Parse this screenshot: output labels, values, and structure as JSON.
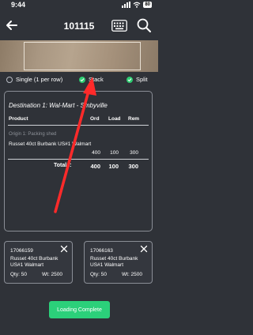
{
  "status_bar": {
    "time": "9:44",
    "battery": "80"
  },
  "header": {
    "title": "101115"
  },
  "modes": [
    {
      "label": "Single (1 per row)",
      "checked": false
    },
    {
      "label": "Stack",
      "checked": true
    },
    {
      "label": "Split",
      "checked": true
    }
  ],
  "order": {
    "destination": "Destination 1: Wal-Mart - Smbyville",
    "columns": [
      "Product",
      "Ord",
      "Load",
      "Rem"
    ],
    "origin": "Origin 1: Packing shed",
    "product": "Russet 40ct Burbank US#1 Walmart",
    "row": {
      "ord": "400",
      "load": "100",
      "rem": "300"
    },
    "totals_label": "Totals:",
    "totals": {
      "ord": "400",
      "load": "100",
      "rem": "300"
    }
  },
  "pallets": [
    {
      "id": "17066159",
      "product": "Russet 40ct Burbank US#1 Walmart",
      "qty": "Qty: 50",
      "wt": "Wt: 2500"
    },
    {
      "id": "17066163",
      "product": "Russet 40ct Burbank US#1 Walmart",
      "qty": "Qty: 50",
      "wt": "Wt: 2500"
    }
  ],
  "actions": {
    "complete_label": "Loading Complete"
  },
  "colors": {
    "background": "#2f3238",
    "accent_green": "#2bd07a",
    "annotation_arrow": "#ff2a2a"
  },
  "icons": [
    "back-arrow-icon",
    "keyboard-icon",
    "search-icon",
    "close-icon"
  ]
}
